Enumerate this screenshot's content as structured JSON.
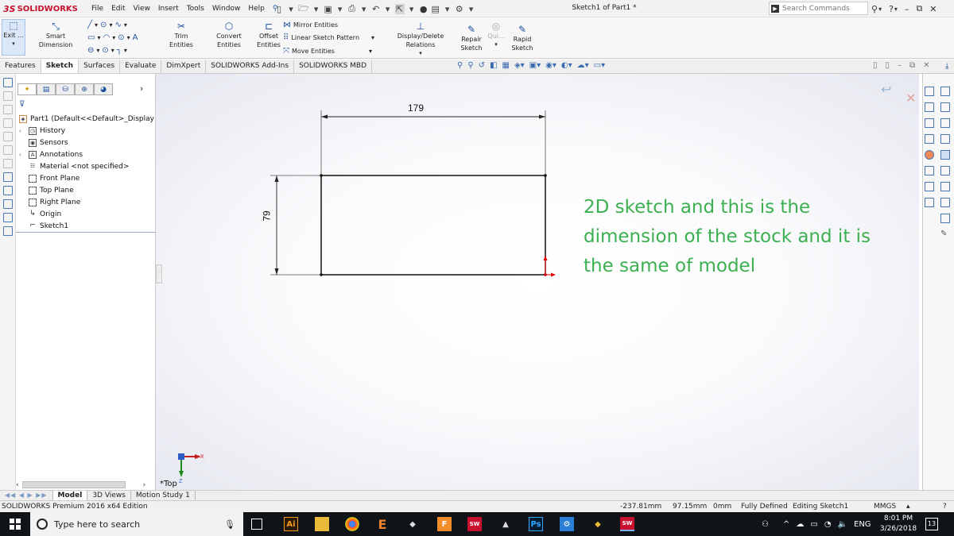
{
  "app": {
    "logo_ds": "3S",
    "logo_text": "SOLIDWORKS",
    "document_title": "Sketch1 of Part1 *",
    "search_placeholder": "Search Commands"
  },
  "menu": [
    "File",
    "Edit",
    "View",
    "Insert",
    "Tools",
    "Window",
    "Help"
  ],
  "ribbon": {
    "exit_label": "Exit ...",
    "smart_dimension": "Smart Dimension",
    "trim_entities": "Trim Entities",
    "convert_entities": "Convert Entities",
    "offset_entities_1": "Offset",
    "offset_entities_2": "Entities",
    "mirror_entities": "Mirror Entities",
    "linear_sketch_pattern": "Linear Sketch Pattern",
    "move_entities": "Move Entities",
    "display_delete_relations": "Display/Delete Relations",
    "repair_sketch_1": "Repair",
    "repair_sketch_2": "Sketch",
    "quick_snaps": "Qui...",
    "rapid_sketch_1": "Rapid",
    "rapid_sketch_2": "Sketch"
  },
  "tabs": [
    {
      "label": "Features",
      "active": false
    },
    {
      "label": "Sketch",
      "active": true
    },
    {
      "label": "Surfaces",
      "active": false
    },
    {
      "label": "Evaluate",
      "active": false
    },
    {
      "label": "DimXpert",
      "active": false
    },
    {
      "label": "SOLIDWORKS Add-Ins",
      "active": false
    },
    {
      "label": "SOLIDWORKS MBD",
      "active": false
    }
  ],
  "feature_tree": {
    "root": "Part1  (Default<<Default>_Display Sta",
    "items": [
      {
        "label": "History",
        "icon": "history-icon",
        "expandable": true
      },
      {
        "label": "Sensors",
        "icon": "sensors-icon",
        "expandable": false
      },
      {
        "label": "Annotations",
        "icon": "annotations-icon",
        "expandable": true
      },
      {
        "label": "Material <not specified>",
        "icon": "material-icon",
        "expandable": false
      },
      {
        "label": "Front Plane",
        "icon": "plane-icon",
        "expandable": false
      },
      {
        "label": "Top Plane",
        "icon": "plane-icon",
        "expandable": false
      },
      {
        "label": "Right Plane",
        "icon": "plane-icon",
        "expandable": false
      },
      {
        "label": "Origin",
        "icon": "origin-icon",
        "expandable": false
      },
      {
        "label": "Sketch1",
        "icon": "sketch-icon",
        "expandable": false
      }
    ]
  },
  "sketch": {
    "dim_width": "179",
    "dim_height": "79",
    "note": "2D sketch and this is the dimension of the stock and it is the same of model",
    "note_color": "#3cb050",
    "view_label": "*Top"
  },
  "bottom_tabs": [
    {
      "label": "Model",
      "active": true
    },
    {
      "label": "3D Views",
      "active": false
    },
    {
      "label": "Motion Study 1",
      "active": false
    }
  ],
  "status": {
    "edition": "SOLIDWORKS Premium 2016 x64 Edition",
    "x": "-237.81mm",
    "y": "97.15mm",
    "z": "0mm",
    "defined": "Fully Defined",
    "editing": "Editing Sketch1",
    "units": "MMGS"
  },
  "taskbar": {
    "search_placeholder": "Type here to search",
    "language": "ENG",
    "time": "8:01 PM",
    "date": "3/26/2018",
    "notifications": "13"
  }
}
